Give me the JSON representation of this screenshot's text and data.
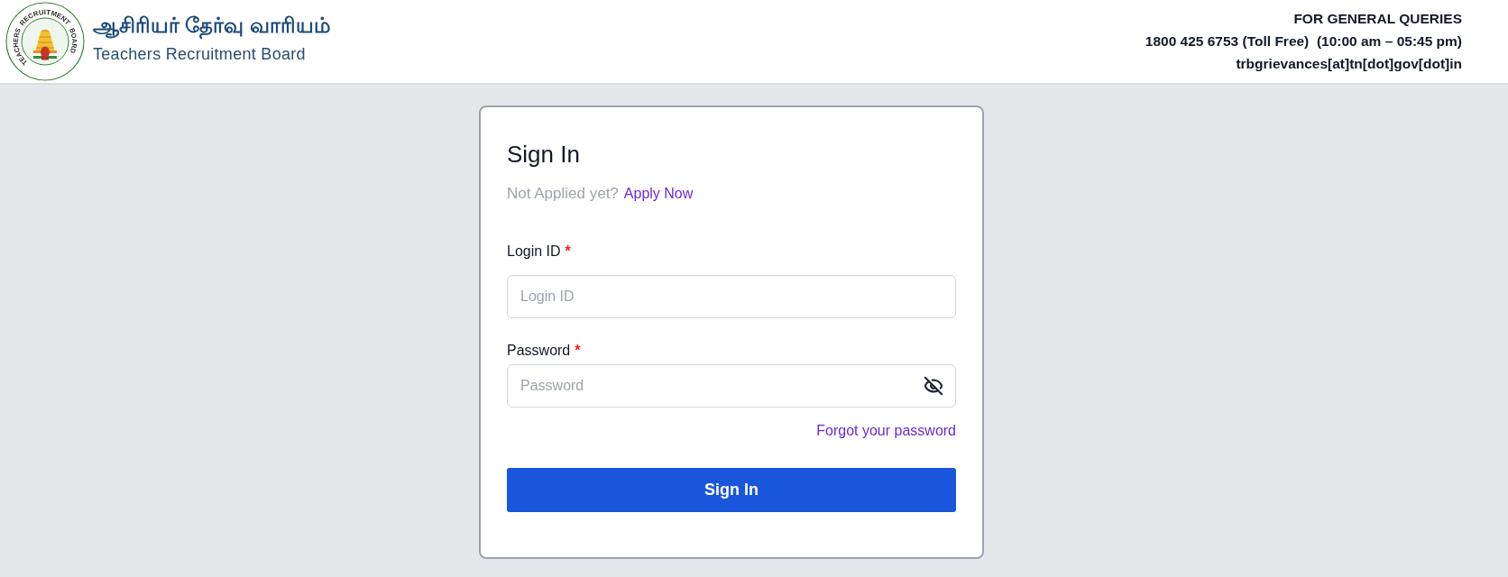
{
  "header": {
    "logo_ring_words": [
      "TEACHERS",
      "RECRUITMENT",
      "BOARD"
    ],
    "title_tamil": "ஆசிரியர் தேர்வு வாரியம்",
    "title_english": "Teachers Recruitment Board",
    "contact": [
      "FOR GENERAL QUERIES",
      "1800 425 6753 (Toll Free)  (10:00 am – 05:45 pm)",
      "trbgrievances[at]tn[dot]gov[dot]in"
    ]
  },
  "card": {
    "title": "Sign In",
    "prompt": "Not Applied yet?",
    "prompt_link": "Apply Now",
    "fields": [
      {
        "kind": "text",
        "label": "Login ID",
        "required_mark": "*",
        "placeholder": "Login ID"
      },
      {
        "kind": "password",
        "label": "Password",
        "required_mark": "*",
        "placeholder": "Password",
        "password_shown": false
      }
    ],
    "forgot_link": "Forgot your password",
    "submit": "Sign In"
  }
}
